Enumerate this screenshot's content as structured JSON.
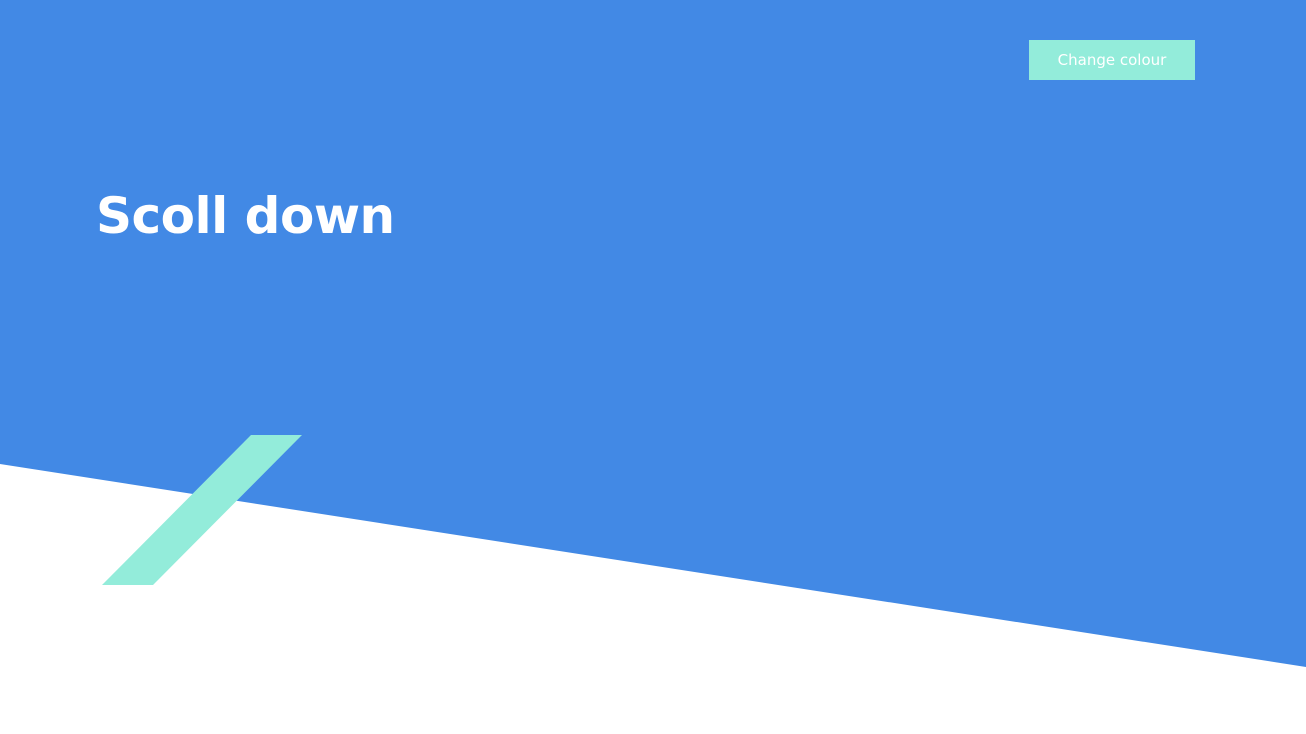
{
  "header": {
    "change_colour_label": "Change colour"
  },
  "hero": {
    "title": "Scoll down"
  },
  "colors": {
    "primary_blue": "#4289e5",
    "accent_mint": "#93ecda",
    "background": "#ffffff",
    "text": "#ffffff"
  },
  "icons": {
    "decorative_stripe": "diagonal-stripe-icon"
  }
}
